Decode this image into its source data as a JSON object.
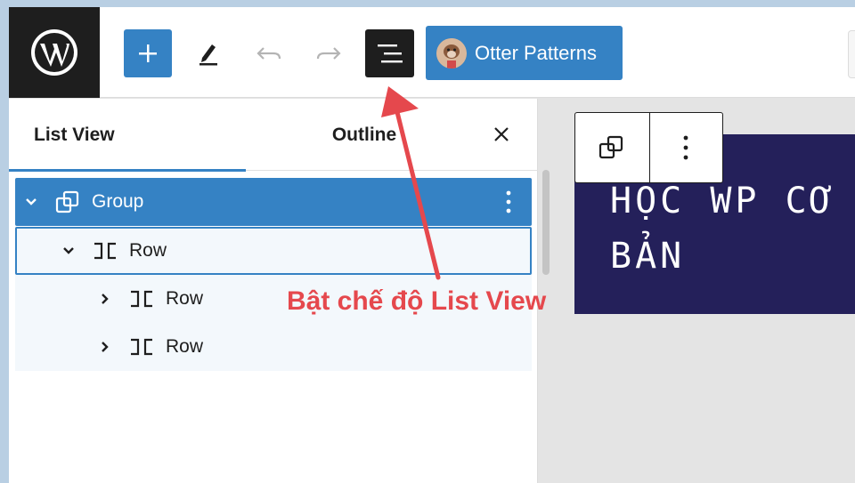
{
  "toolbar": {
    "add_label": "+",
    "otter_label": "Otter Patterns"
  },
  "sidebar": {
    "tabs": [
      {
        "label": "List View",
        "active": true
      },
      {
        "label": "Outline",
        "active": false
      }
    ],
    "tree": [
      {
        "label": "Group",
        "expanded": true,
        "selected": true,
        "icon": "group-icon"
      },
      {
        "label": "Row",
        "expanded": true,
        "selected": false,
        "icon": "row-icon"
      },
      {
        "label": "Row",
        "expanded": false,
        "selected": false,
        "icon": "row-icon"
      },
      {
        "label": "Row",
        "expanded": false,
        "selected": false,
        "icon": "row-icon"
      }
    ]
  },
  "canvas": {
    "heading_line1": "HỌC WP CƠ",
    "heading_line2": "BẢN"
  },
  "annotation": {
    "text": "Bật chế độ List View"
  },
  "colors": {
    "accent": "#3582c4",
    "dark": "#1e1e1e",
    "canvas_bg": "#24205a",
    "annotation": "#e5484d"
  }
}
